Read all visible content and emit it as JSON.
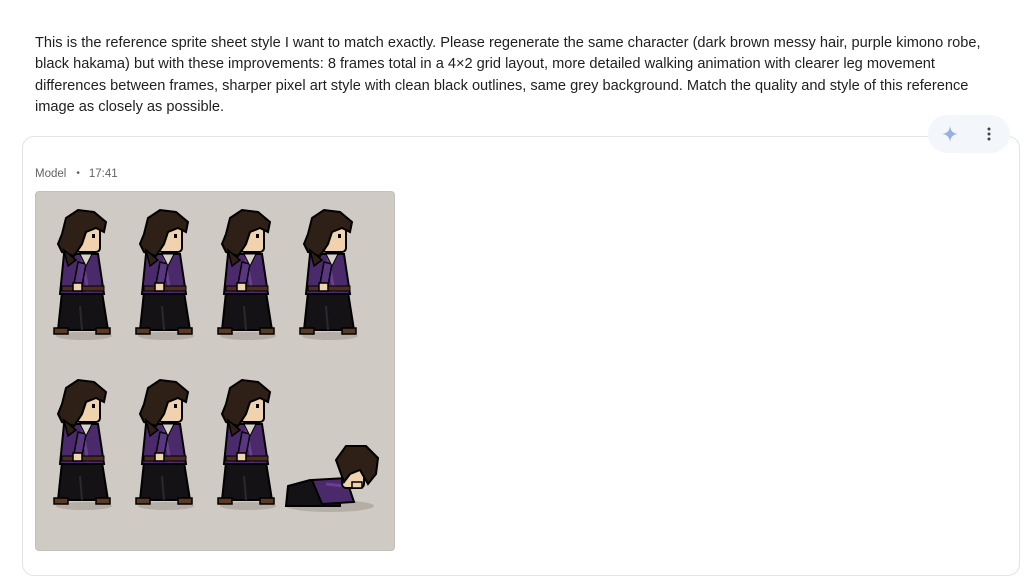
{
  "conversation": {
    "user_message": "This is the reference sprite sheet style I want to match exactly. Please regenerate the same character (dark brown messy hair, purple kimono robe, black hakama) but with these improvements: 8 frames total in a 4×2 grid layout, more detailed walking animation with clearer leg movement differences between frames, sharper pixel art style with clean black outlines, same grey background. Match the quality and style of this reference image as closely as possible.",
    "response": {
      "author": "Model",
      "separator": "•",
      "time": "17:41",
      "image": {
        "description_icon": "sprite-sheet-image",
        "background_color": "#cfcac3",
        "frames": [
          {
            "pose": "walk",
            "row": 1,
            "col": 1,
            "stride": "left"
          },
          {
            "pose": "walk",
            "row": 1,
            "col": 2,
            "stride": "right"
          },
          {
            "pose": "walk",
            "row": 1,
            "col": 3,
            "stride": "left"
          },
          {
            "pose": "walk",
            "row": 1,
            "col": 4,
            "stride": "right"
          },
          {
            "pose": "walk",
            "row": 2,
            "col": 1,
            "stride": "left"
          },
          {
            "pose": "walk",
            "row": 2,
            "col": 2,
            "stride": "right"
          },
          {
            "pose": "walk",
            "row": 2,
            "col": 3,
            "stride": "left"
          },
          {
            "pose": "fallen",
            "row": 2,
            "col": 4,
            "stride": "none"
          }
        ]
      }
    }
  },
  "actions": {
    "sparkle_icon": "sparkle-icon",
    "more_icon": "more-vertical-icon"
  },
  "colors": {
    "hair": "#2e1f17",
    "robe": "#4a2a6a",
    "robe_light": "#6a3f92",
    "hakama": "#141214",
    "skin": "#f0d2ae",
    "outline": "#000000"
  }
}
